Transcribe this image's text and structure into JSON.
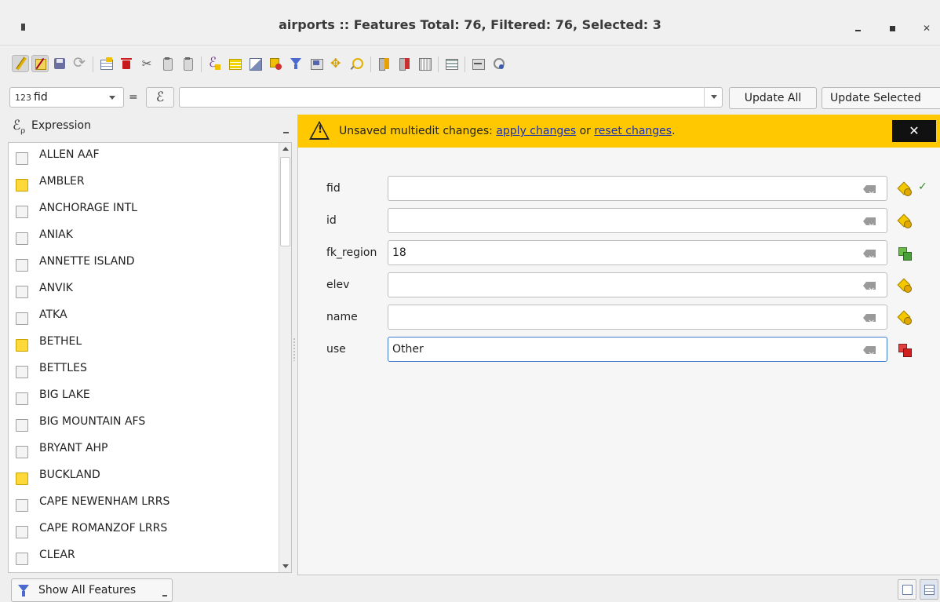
{
  "window": {
    "title": "airports :: Features Total: 76, Filtered: 76, Selected: 3"
  },
  "toolbar": {
    "buttons": [
      {
        "name": "toggle-editing-icon",
        "active": true
      },
      {
        "name": "multi-edit-icon",
        "active": true
      },
      {
        "name": "save-edits-icon"
      },
      {
        "name": "reload-icon"
      },
      {
        "name": "add-feature-icon"
      },
      {
        "name": "delete-feature-icon"
      },
      {
        "name": "cut-icon"
      },
      {
        "name": "copy-icon"
      },
      {
        "name": "paste-icon"
      },
      {
        "name": "select-by-expression-icon"
      },
      {
        "name": "select-all-icon"
      },
      {
        "name": "invert-selection-icon"
      },
      {
        "name": "deselect-all-icon"
      },
      {
        "name": "filter-selected-icon"
      },
      {
        "name": "move-selection-to-top-icon"
      },
      {
        "name": "pan-to-selection-icon"
      },
      {
        "name": "zoom-to-selection-icon"
      },
      {
        "name": "new-field-icon"
      },
      {
        "name": "delete-field-icon"
      },
      {
        "name": "field-calculator-icon"
      },
      {
        "name": "conditional-formatting-icon"
      },
      {
        "name": "actions-icon"
      },
      {
        "name": "dock-table-icon"
      }
    ]
  },
  "calc_bar": {
    "field_type": "123",
    "field": "fid",
    "equals": "=",
    "expression_symbol": "ℰ",
    "expression_value": "",
    "update_all_label": "Update All",
    "update_selected_label": "Update Selected"
  },
  "left_panel": {
    "header_label": "Expression",
    "header_symbol": "ℰ",
    "items": [
      {
        "label": "ALLEN AAF",
        "selected": false
      },
      {
        "label": "AMBLER",
        "selected": true
      },
      {
        "label": "ANCHORAGE INTL",
        "selected": false
      },
      {
        "label": "ANIAK",
        "selected": false
      },
      {
        "label": "ANNETTE ISLAND",
        "selected": false
      },
      {
        "label": "ANVIK",
        "selected": false
      },
      {
        "label": "ATKA",
        "selected": false
      },
      {
        "label": "BETHEL",
        "selected": true
      },
      {
        "label": "BETTLES",
        "selected": false
      },
      {
        "label": "BIG LAKE",
        "selected": false
      },
      {
        "label": "BIG MOUNTAIN AFS",
        "selected": false
      },
      {
        "label": "BRYANT AHP",
        "selected": false
      },
      {
        "label": "BUCKLAND",
        "selected": true
      },
      {
        "label": "CAPE NEWENHAM LRRS",
        "selected": false
      },
      {
        "label": "CAPE ROMANZOF LRRS",
        "selected": false
      },
      {
        "label": "CLEAR",
        "selected": false
      }
    ]
  },
  "message_bar": {
    "text_before": "Unsaved multiedit changes: ",
    "apply_link": "apply changes",
    "text_middle": " or ",
    "reset_link": "reset changes",
    "text_after": ".",
    "close_label": "✕",
    "warn_mark": "!",
    "color": "#ffc800"
  },
  "form": {
    "fields": [
      {
        "label": "fid",
        "value": "",
        "status": "mixed",
        "check": "✓"
      },
      {
        "label": "id",
        "value": "",
        "status": "mixed",
        "check": ""
      },
      {
        "label": "fk_region",
        "value": "18",
        "status": "same",
        "check": ""
      },
      {
        "label": "elev",
        "value": "",
        "status": "mixed",
        "check": ""
      },
      {
        "label": "name",
        "value": "",
        "status": "mixed",
        "check": ""
      },
      {
        "label": "use",
        "value": "Other",
        "status": "changed",
        "check": "",
        "focused": true
      }
    ]
  },
  "bottom_bar": {
    "show_all_label": "Show All Features"
  }
}
